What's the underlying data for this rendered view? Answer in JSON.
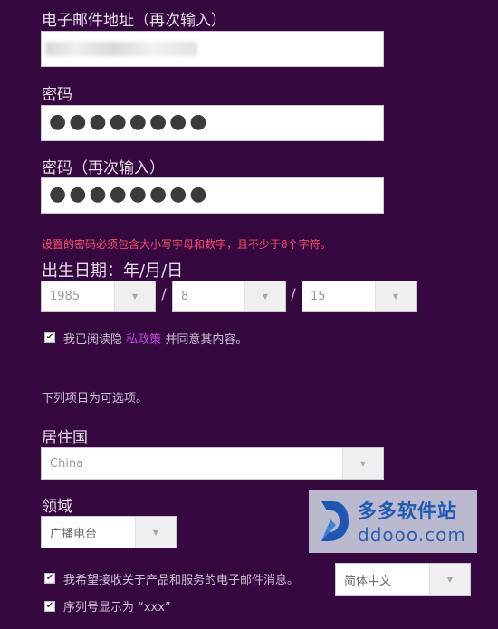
{
  "email_confirm": {
    "label": "电子邮件地址（再次输入）",
    "value": ""
  },
  "password": {
    "label": "密码",
    "value": "●●●●●●●●"
  },
  "password_confirm": {
    "label": "密码（再次输入）",
    "value": "●●●●●●●●"
  },
  "password_error": "设置的密码必须包含大小写字母和数字，且不少于8个字符。",
  "birthdate": {
    "label": "出生日期：年/月/日",
    "year": "1985",
    "month": "8",
    "day": "15",
    "separator": "/"
  },
  "privacy": {
    "checked": true,
    "text_before": "我已阅读隐",
    "link": "私政策",
    "text_after": "并同意其内容。"
  },
  "optional_note": "下列项目为可选项。",
  "country": {
    "label": "居住国",
    "value": "China"
  },
  "field_area": {
    "label": "领域",
    "value": "广播电台"
  },
  "newsletter": {
    "checked": true,
    "text": "我希望接收关于产品和服务的电子邮件消息。",
    "language": "简体中文"
  },
  "serial_display": {
    "checked": true,
    "text": "序列号显示为 “xxx”"
  },
  "watermark": {
    "name": "多多软件站",
    "url": "ddooo.com"
  },
  "icons": {
    "dropdown": "chevron-down-icon",
    "checkbox": "checkmark-icon"
  }
}
